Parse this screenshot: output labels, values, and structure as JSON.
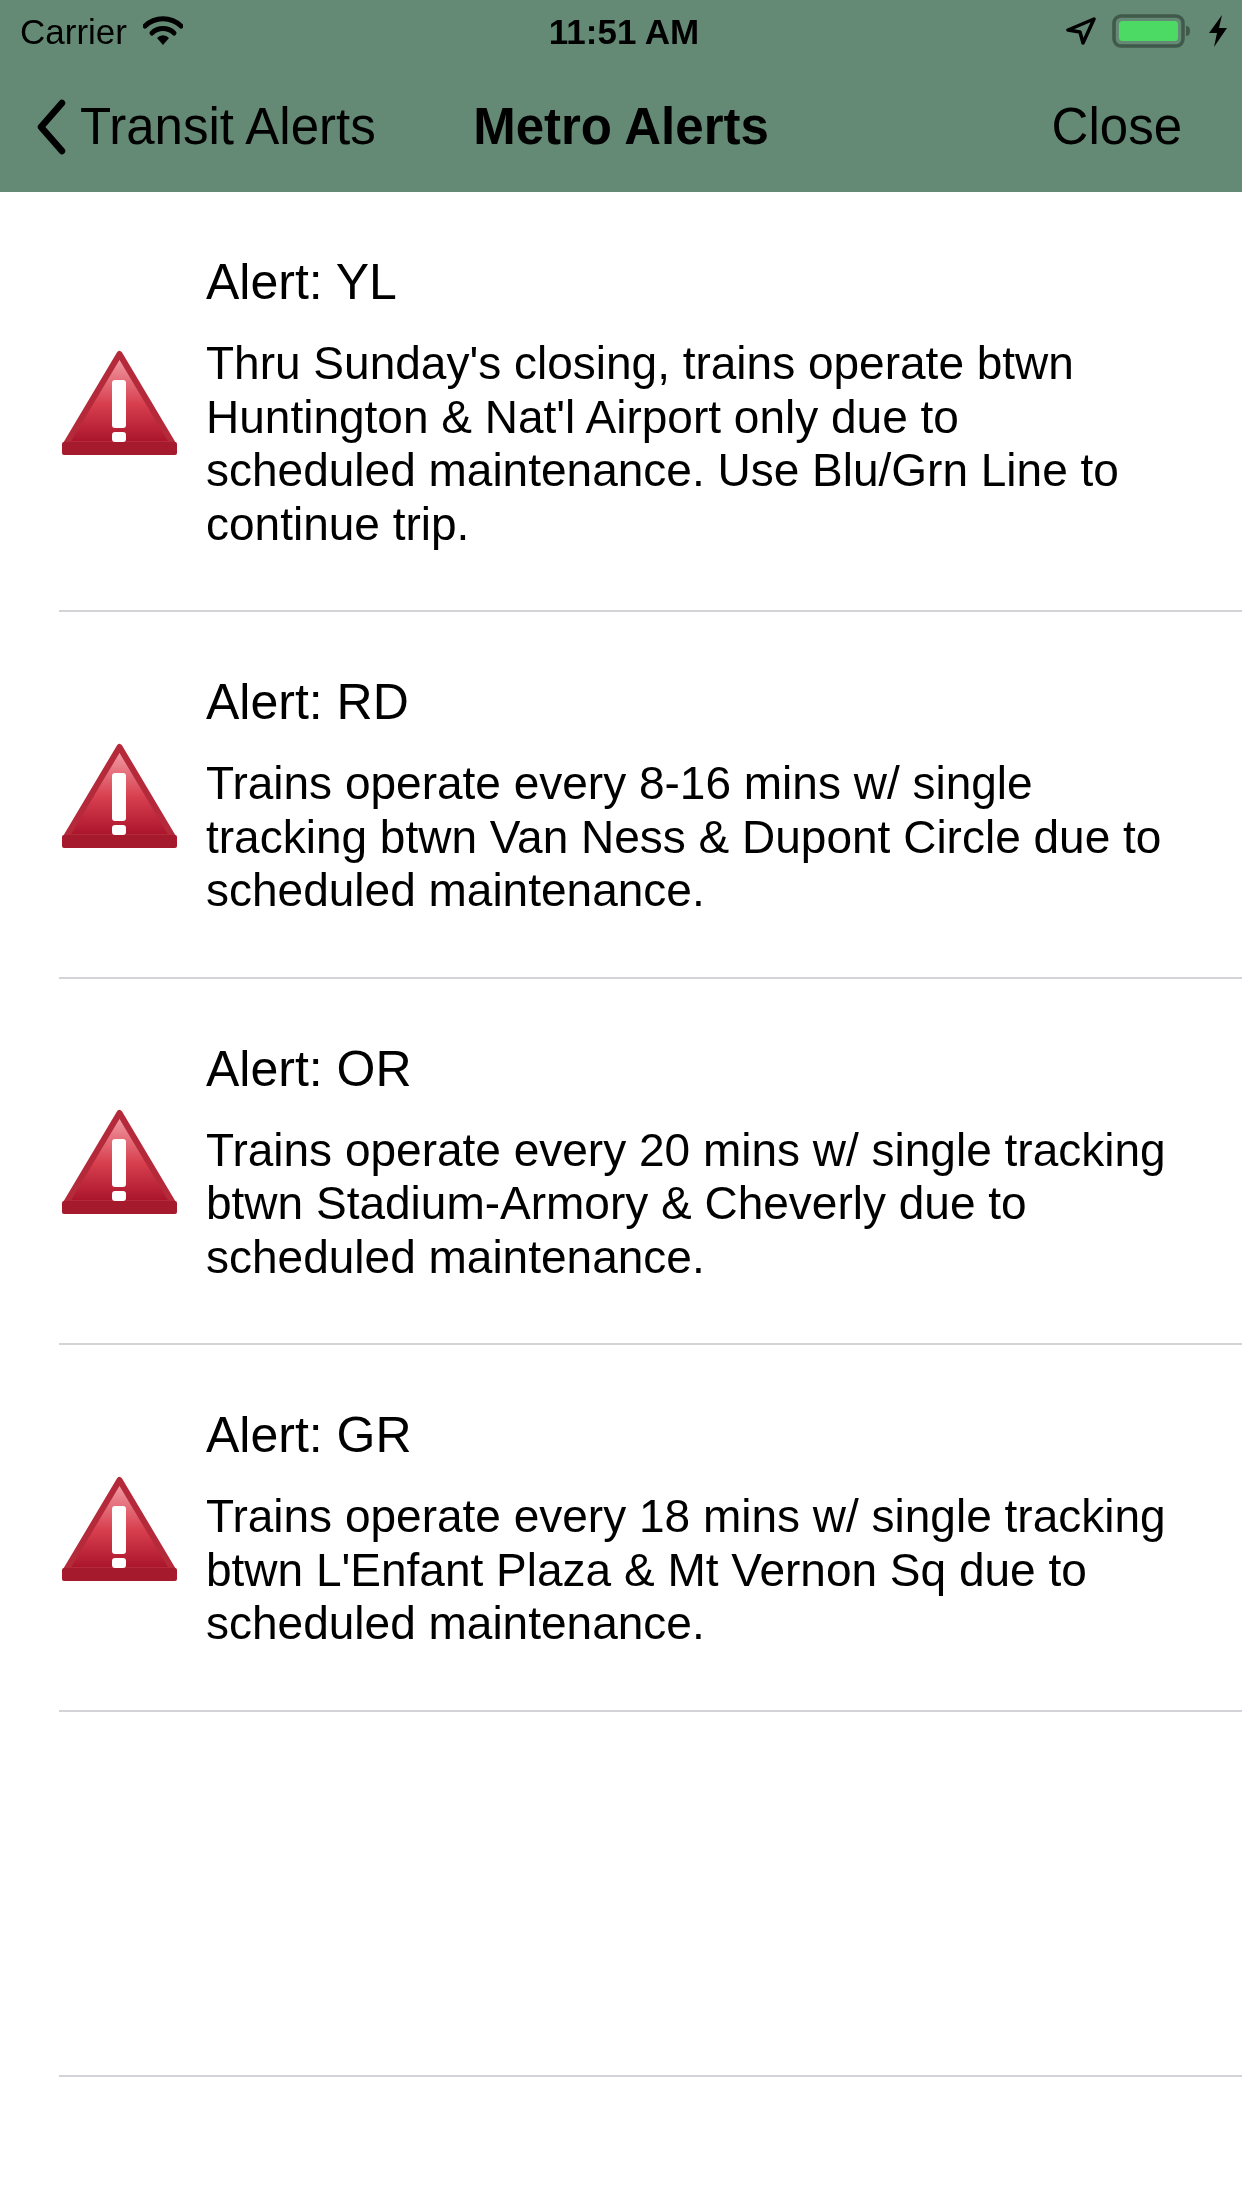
{
  "status_bar": {
    "carrier": "Carrier",
    "time": "11:51 AM"
  },
  "nav_bar": {
    "back_label": "Transit Alerts",
    "title": "Metro Alerts",
    "action": "Close"
  },
  "alerts": [
    {
      "title": "Alert: YL",
      "message": "Thru Sunday's closing, trains operate btwn Huntington & Nat'l Airport only due to scheduled maintenance. Use Blu/Grn Line to continue trip."
    },
    {
      "title": "Alert: RD",
      "message": "Trains operate every 8-16 mins w/ single tracking btwn Van Ness & Dupont Circle due to scheduled maintenance."
    },
    {
      "title": "Alert: OR",
      "message": "Trains operate every 20 mins w/ single tracking btwn Stadium-Armory & Cheverly due to scheduled maintenance."
    },
    {
      "title": "Alert: GR",
      "message": "Trains operate every 18 mins w/ single tracking btwn L'Enfant Plaza & Mt Vernon Sq due to scheduled maintenance."
    }
  ]
}
